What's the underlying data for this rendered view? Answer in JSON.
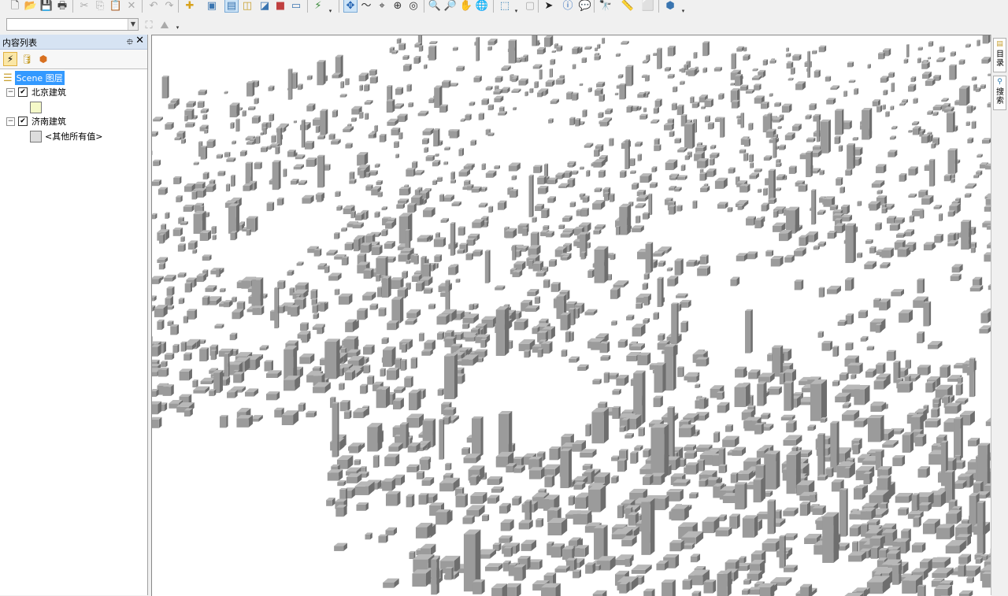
{
  "toolbar1": {
    "buttons": [
      {
        "name": "new-document-icon",
        "glyph": "🗋",
        "color": "#444444"
      },
      {
        "name": "open-folder-icon",
        "glyph": "📂",
        "color": "#d8a21d"
      },
      {
        "name": "save-icon",
        "glyph": "💾",
        "color": "#355a99"
      },
      {
        "name": "print-icon",
        "glyph": "🖶",
        "color": "#444444"
      },
      {
        "name": "cut-icon",
        "glyph": "✂",
        "color": "#aaaaaa"
      },
      {
        "name": "copy-icon",
        "glyph": "⎘",
        "color": "#aaaaaa"
      },
      {
        "name": "paste-icon",
        "glyph": "📋",
        "color": "#aaaaaa"
      },
      {
        "name": "delete-icon",
        "glyph": "✕",
        "color": "#aaaaaa"
      },
      {
        "name": "undo-icon",
        "glyph": "↶",
        "color": "#aaaaaa"
      },
      {
        "name": "redo-icon",
        "glyph": "↷",
        "color": "#aaaaaa"
      },
      {
        "name": "add-data-icon",
        "glyph": "✚",
        "color": "#d8a21d"
      },
      {
        "name": "image-icon",
        "glyph": "▣",
        "color": "#3a75b0"
      },
      {
        "name": "layer-properties-icon",
        "glyph": "▤",
        "color": "#3a75b0"
      },
      {
        "name": "catalog-icon",
        "glyph": "◫",
        "color": "#c8a030"
      },
      {
        "name": "arctoolbox-icon",
        "glyph": "◪",
        "color": "#3a75b0"
      },
      {
        "name": "toolbox-icon",
        "glyph": "■",
        "color": "#c04040"
      },
      {
        "name": "python-window-icon",
        "glyph": "▭",
        "color": "#3a75b0"
      },
      {
        "name": "model-builder-icon",
        "glyph": "⚡",
        "color": "#3a8a3a"
      },
      {
        "name": "navigate-icon",
        "glyph": "✥",
        "color": "#2060b0"
      },
      {
        "name": "fly-icon",
        "glyph": "〜",
        "color": "#333333"
      },
      {
        "name": "center-target-icon",
        "glyph": "⌖",
        "color": "#333333"
      },
      {
        "name": "zoom-to-target-icon",
        "glyph": "⊕",
        "color": "#333333"
      },
      {
        "name": "set-observer-icon",
        "glyph": "◎",
        "color": "#333333"
      },
      {
        "name": "zoom-in-icon",
        "glyph": "🔍",
        "color": "#333333"
      },
      {
        "name": "zoom-out-icon",
        "glyph": "🔎",
        "color": "#333333"
      },
      {
        "name": "pan-icon",
        "glyph": "✋",
        "color": "#555555"
      },
      {
        "name": "full-extent-icon",
        "glyph": "🌐",
        "color": "#2a7ab0"
      },
      {
        "name": "select-features-icon",
        "glyph": "⬚",
        "color": "#2a7ab0"
      },
      {
        "name": "clear-selection-icon",
        "glyph": "▢",
        "color": "#aaaaaa"
      },
      {
        "name": "select-elements-icon",
        "glyph": "➤",
        "color": "#222222"
      },
      {
        "name": "identify-icon",
        "glyph": "ⓘ",
        "color": "#1e5fb8"
      },
      {
        "name": "html-popup-icon",
        "glyph": "💬",
        "color": "#2a7ab0"
      },
      {
        "name": "find-icon",
        "glyph": "🔭",
        "color": "#333333"
      },
      {
        "name": "measure-icon",
        "glyph": "📏",
        "color": "#c8a030"
      },
      {
        "name": "animation-icon",
        "glyph": "⬜",
        "color": "#aaaaaa"
      },
      {
        "name": "scene-properties-icon",
        "glyph": "⬢",
        "color": "#3a75b0"
      }
    ]
  },
  "toolbar2": {
    "combo_value": "",
    "buttons": [
      {
        "name": "geocode-icon",
        "glyph": "⛶",
        "color": "#aaaaaa"
      },
      {
        "name": "route-icon",
        "glyph": "⛰",
        "color": "#aaaaaa"
      }
    ]
  },
  "toc": {
    "title": "内容列表",
    "pin": "ᵾ",
    "close": "✕",
    "tools": [
      {
        "name": "list-by-drawing-order-icon",
        "glyph": "⚡",
        "color": "#3a7ab0"
      },
      {
        "name": "list-by-source-icon",
        "glyph": "🛢",
        "color": "#c8a030"
      },
      {
        "name": "list-by-visibility-icon",
        "glyph": "⬢",
        "color": "#d87020"
      }
    ],
    "scene": {
      "label": "Scene 图层"
    },
    "layers": [
      {
        "name": "北京建筑",
        "checked": true,
        "legend_label": "",
        "swatch": "#f5f9c8"
      },
      {
        "name": "济南建筑",
        "checked": true,
        "legend_label": "<其他所有值>",
        "swatch": "#dcdcdc"
      }
    ]
  },
  "rightbar": {
    "tabs": [
      {
        "label": "目录",
        "icon": "catalog-icon"
      },
      {
        "label": "搜索",
        "icon": "search-icon"
      }
    ]
  },
  "colors": {
    "building_face": "#9b9b9b",
    "building_roof": "#b8b8b8",
    "building_shadow": "#6e6e6e",
    "background": "#ffffff"
  }
}
